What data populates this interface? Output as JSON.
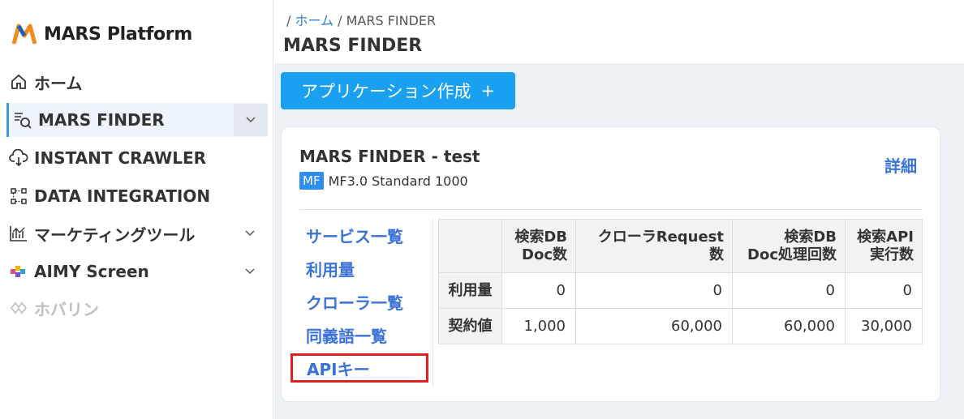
{
  "app": {
    "logo_text": "MARS Platform"
  },
  "sidebar": {
    "items": [
      {
        "label": "ホーム",
        "icon": "home-icon"
      },
      {
        "label": "MARS FINDER",
        "icon": "search-list-icon",
        "active": true,
        "expandable": true
      },
      {
        "label": "INSTANT CRAWLER",
        "icon": "cloud-download-icon"
      },
      {
        "label": "DATA INTEGRATION",
        "icon": "data-flow-icon"
      },
      {
        "label": "マーケティングツール",
        "icon": "chart-icon",
        "expandable": true
      },
      {
        "label": "AIMY Screen",
        "icon": "aimy-logo-icon",
        "expandable": true
      },
      {
        "label": "ホバリン",
        "icon": "hover-icon",
        "disabled": true
      }
    ]
  },
  "header": {
    "breadcrumb_sep1": "/",
    "breadcrumb_home": "ホーム",
    "breadcrumb_sep2": "/",
    "breadcrumb_current": "MARS FINDER",
    "title": "MARS FINDER"
  },
  "actions": {
    "create_label": "アプリケーション作成",
    "create_icon": "+"
  },
  "card": {
    "title": "MARS FINDER - test",
    "badge": "MF",
    "plan": "MF3.0 Standard 1000",
    "detail_label": "詳細"
  },
  "submenu": [
    {
      "label": "サービス一覧"
    },
    {
      "label": "利用量"
    },
    {
      "label": "クローラ一覧"
    },
    {
      "label": "同義語一覧"
    },
    {
      "label": "APIキー",
      "highlighted": true
    }
  ],
  "table": {
    "headers": [
      "",
      "検索DB\nDoc数",
      "クローラRequest数",
      "検索DB\nDoc処理回数",
      "検索API\n実行数"
    ],
    "header_lines": [
      [
        "検索DB",
        "Doc数"
      ],
      [
        "クローラRequest数"
      ],
      [
        "検索DB",
        "Doc処理回数"
      ],
      [
        "検索API",
        "実行数"
      ]
    ],
    "rows": [
      {
        "label": "利用量",
        "values": [
          "0",
          "0",
          "0",
          "0"
        ]
      },
      {
        "label": "契約値",
        "values": [
          "1,000",
          "60,000",
          "60,000",
          "30,000"
        ]
      }
    ]
  },
  "colors": {
    "accent": "#1aa0f0",
    "link": "#3a72d8",
    "highlight_border": "#e02020"
  }
}
